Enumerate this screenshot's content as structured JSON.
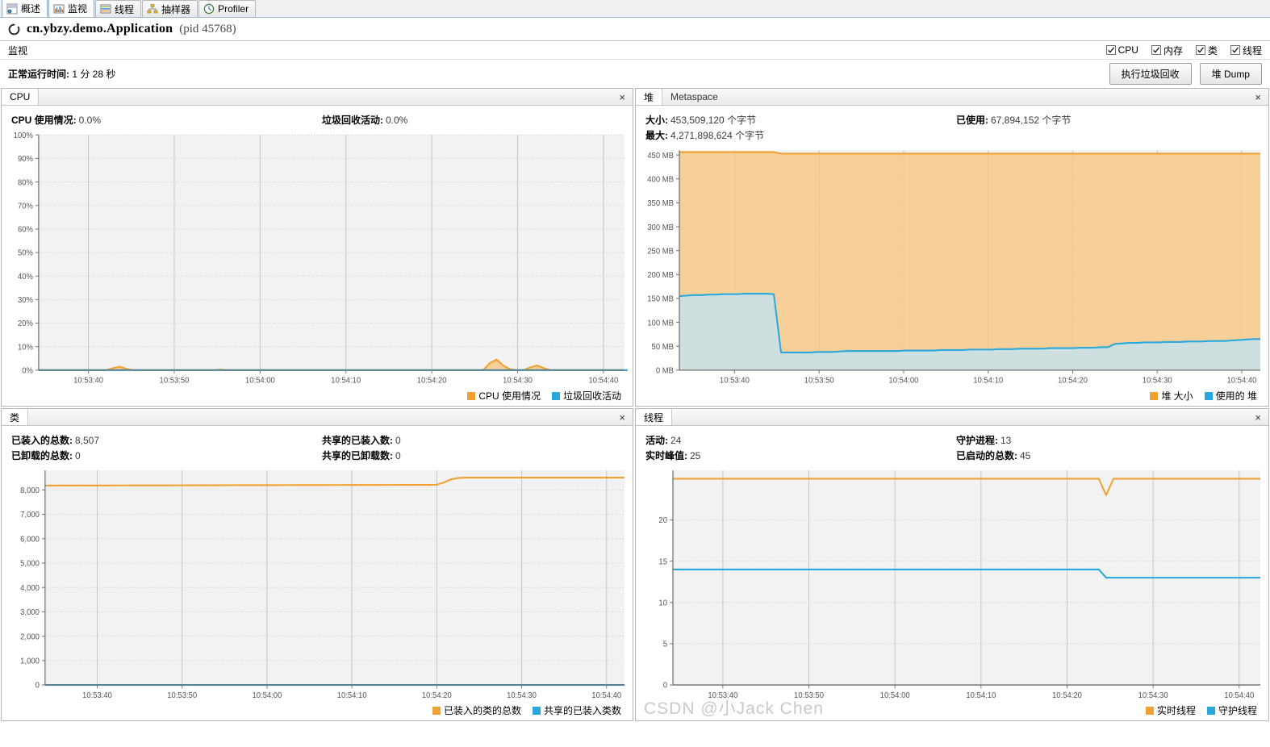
{
  "tabs": [
    {
      "label": "概述",
      "icon": "overview-icon",
      "active": false
    },
    {
      "label": "监视",
      "icon": "monitor-icon",
      "active": true
    },
    {
      "label": "线程",
      "icon": "threads-icon",
      "active": false
    },
    {
      "label": "抽样器",
      "icon": "sampler-icon",
      "active": false
    },
    {
      "label": "Profiler",
      "icon": "profiler-icon",
      "active": false
    }
  ],
  "app": {
    "name": "cn.ybzy.demo.Application",
    "pid": "(pid 45768)"
  },
  "monitor": {
    "label": "监视",
    "checkboxes": [
      {
        "label": "CPU",
        "checked": true
      },
      {
        "label": "内存",
        "checked": true
      },
      {
        "label": "类",
        "checked": true
      },
      {
        "label": "线程",
        "checked": true
      }
    ]
  },
  "uptime": {
    "label": "正常运行时间:",
    "value": "1 分 28 秒"
  },
  "buttons": {
    "gc": "执行垃圾回收",
    "heap_dump": "堆 Dump"
  },
  "colors": {
    "orange": "#f0a132",
    "orange_fill": "#f7c98a",
    "blue": "#29a8dd",
    "blue_fill": "#bfe6f7",
    "grid": "#cfcfcf",
    "plot_bg": "#f2f2f2",
    "axis": "#777777",
    "text": "#555555"
  },
  "panels": {
    "cpu": {
      "title": "CPU",
      "close": "×",
      "stats": [
        {
          "label": "CPU 使用情况:",
          "value": "0.0%"
        },
        {
          "label": "垃圾回收活动:",
          "value": "0.0%"
        }
      ],
      "legend": [
        {
          "label": "CPU 使用情况",
          "color": "#f0a132"
        },
        {
          "label": "垃圾回收活动",
          "color": "#29a8dd"
        }
      ]
    },
    "heap": {
      "title": "堆",
      "tab2": "Metaspace",
      "close": "×",
      "stats": [
        {
          "label": "大小:",
          "value": "453,509,120 个字节"
        },
        {
          "label": "已使用:",
          "value": "67,894,152 个字节"
        },
        {
          "label": "最大:",
          "value": "4,271,898,624 个字节"
        }
      ],
      "legend": [
        {
          "label": "堆 大小",
          "color": "#f0a132"
        },
        {
          "label": "使用的 堆",
          "color": "#29a8dd"
        }
      ]
    },
    "classes": {
      "title": "类",
      "close": "×",
      "stats": [
        {
          "label": "已装入的总数:",
          "value": "8,507"
        },
        {
          "label": "共享的已装入数:",
          "value": "0"
        },
        {
          "label": "已卸载的总数:",
          "value": "0"
        },
        {
          "label": "共享的已卸载数:",
          "value": "0"
        }
      ],
      "legend": [
        {
          "label": "已装入的类的总数",
          "color": "#f0a132"
        },
        {
          "label": "共享的已装入类数",
          "color": "#29a8dd"
        }
      ]
    },
    "threads": {
      "title": "线程",
      "close": "×",
      "stats": [
        {
          "label": "活动:",
          "value": "24"
        },
        {
          "label": "守护进程:",
          "value": "13"
        },
        {
          "label": "实时峰值:",
          "value": "25"
        },
        {
          "label": "已启动的总数:",
          "value": "45"
        }
      ],
      "legend": [
        {
          "label": "实时线程",
          "color": "#f0a132"
        },
        {
          "label": "守护线程",
          "color": "#29a8dd"
        }
      ]
    }
  },
  "watermark": "CSDN @小Jack Chen",
  "chart_data": [
    {
      "type": "area",
      "name": "cpu",
      "title": "CPU",
      "xlabel": "",
      "ylabel": "",
      "grid": true,
      "legend_position": "bottom-right",
      "xticks": [
        "10:53:40",
        "10:53:50",
        "10:54:00",
        "10:54:10",
        "10:54:20",
        "10:54:30",
        "10:54:40"
      ],
      "yticks": [
        "0%",
        "10%",
        "20%",
        "30%",
        "40%",
        "50%",
        "60%",
        "70%",
        "80%",
        "90%",
        "100%"
      ],
      "ylim": [
        0,
        100
      ],
      "series": [
        {
          "name": "CPU 使用情况",
          "color": "#f0a132",
          "values": [
            0,
            0,
            0,
            0,
            0,
            0,
            0,
            0,
            0,
            0,
            0,
            0.8,
            1.5,
            0.6,
            0,
            0,
            0,
            0,
            0,
            0,
            0,
            0,
            0,
            0,
            0,
            0,
            0,
            0.3,
            0,
            0,
            0,
            0,
            0,
            0,
            0,
            0,
            0,
            0,
            0,
            0,
            0,
            0,
            0,
            0,
            0,
            0,
            0,
            0,
            0,
            0,
            0,
            0,
            0,
            0,
            0,
            0,
            0,
            0,
            0,
            0,
            0,
            0,
            0,
            0,
            0,
            0,
            0,
            3.0,
            4.5,
            2.0,
            0.4,
            0,
            0,
            1.2,
            2.0,
            0.9,
            0,
            0,
            0,
            0,
            0,
            0,
            0,
            0,
            0,
            0,
            0,
            0
          ]
        },
        {
          "name": "垃圾回收活动",
          "color": "#29a8dd",
          "values": [
            0,
            0,
            0,
            0,
            0,
            0,
            0,
            0,
            0,
            0,
            0,
            0,
            0,
            0,
            0,
            0,
            0,
            0,
            0,
            0,
            0,
            0,
            0,
            0,
            0,
            0,
            0,
            0,
            0,
            0,
            0,
            0,
            0,
            0,
            0,
            0,
            0,
            0,
            0,
            0,
            0,
            0,
            0,
            0,
            0,
            0,
            0,
            0,
            0,
            0,
            0,
            0,
            0,
            0,
            0,
            0,
            0,
            0,
            0,
            0,
            0,
            0,
            0,
            0,
            0,
            0,
            0,
            0,
            0,
            0,
            0,
            0,
            0,
            0,
            0,
            0,
            0,
            0,
            0,
            0,
            0,
            0,
            0,
            0,
            0,
            0,
            0,
            0,
            0,
            0,
            0
          ]
        }
      ]
    },
    {
      "type": "area",
      "name": "heap",
      "title": "堆",
      "xlabel": "",
      "ylabel": "MB",
      "grid": true,
      "legend_position": "bottom-right",
      "xticks": [
        "10:53:40",
        "10:53:50",
        "10:54:00",
        "10:54:10",
        "10:54:20",
        "10:54:30",
        "10:54:40"
      ],
      "yticks": [
        "0 MB",
        "50 MB",
        "100 MB",
        "150 MB",
        "200 MB",
        "250 MB",
        "300 MB",
        "350 MB",
        "400 MB",
        "450 MB"
      ],
      "ylim": [
        0,
        460
      ],
      "series": [
        {
          "name": "堆 大小",
          "color": "#f0a132",
          "values": [
            456,
            456,
            456,
            456,
            456,
            456,
            456,
            456,
            456,
            456,
            456,
            456,
            456,
            456,
            453,
            453,
            453,
            453,
            453,
            453,
            453,
            453,
            453,
            453,
            453,
            453,
            453,
            453,
            453,
            453,
            453,
            453,
            453,
            453,
            453,
            453,
            453,
            453,
            453,
            453,
            453,
            453,
            453,
            453,
            453,
            453,
            453,
            453,
            453,
            453,
            453,
            453,
            453,
            453,
            453,
            453,
            453,
            453,
            453,
            453,
            453,
            453,
            453,
            453,
            453,
            453,
            453,
            453,
            453,
            453,
            453,
            453,
            453,
            453,
            453,
            453,
            453,
            453,
            453,
            453,
            453
          ]
        },
        {
          "name": "使用的 堆",
          "color": "#29a8dd",
          "values": [
            155,
            156,
            157,
            157,
            158,
            158,
            159,
            159,
            159,
            160,
            160,
            160,
            160,
            159,
            37,
            37,
            37,
            37,
            37,
            38,
            38,
            38,
            39,
            40,
            40,
            40,
            40,
            40,
            40,
            40,
            40,
            41,
            41,
            41,
            41,
            41,
            42,
            42,
            42,
            42,
            43,
            43,
            43,
            43,
            44,
            44,
            44,
            45,
            45,
            45,
            45,
            46,
            46,
            46,
            46,
            47,
            47,
            47,
            48,
            48,
            55,
            56,
            57,
            57,
            58,
            58,
            58,
            59,
            59,
            59,
            60,
            60,
            60,
            61,
            61,
            61,
            62,
            63,
            64,
            65,
            65
          ]
        }
      ]
    },
    {
      "type": "line",
      "name": "classes",
      "title": "类",
      "xlabel": "",
      "ylabel": "",
      "grid": true,
      "legend_position": "bottom-right",
      "xticks": [
        "10:53:40",
        "10:53:50",
        "10:54:00",
        "10:54:10",
        "10:54:20",
        "10:54:30",
        "10:54:40"
      ],
      "yticks": [
        "0",
        "1,000",
        "2,000",
        "3,000",
        "4,000",
        "5,000",
        "6,000",
        "7,000",
        "8,000"
      ],
      "ylim": [
        0,
        8800
      ],
      "series": [
        {
          "name": "已装入的类的总数",
          "color": "#f0a132",
          "values": [
            8180,
            8180,
            8182,
            8182,
            8183,
            8183,
            8184,
            8184,
            8185,
            8185,
            8186,
            8186,
            8187,
            8187,
            8188,
            8188,
            8189,
            8189,
            8190,
            8190,
            8191,
            8191,
            8192,
            8193,
            8193,
            8194,
            8194,
            8195,
            8195,
            8196,
            8196,
            8197,
            8197,
            8198,
            8198,
            8199,
            8200,
            8200,
            8201,
            8201,
            8202,
            8202,
            8203,
            8203,
            8204,
            8205,
            8205,
            8206,
            8206,
            8207,
            8207,
            8208,
            8208,
            8209,
            8210,
            8300,
            8430,
            8490,
            8505,
            8507,
            8507,
            8507,
            8507,
            8507,
            8507,
            8507,
            8507,
            8507,
            8507,
            8507,
            8507,
            8507,
            8507,
            8507,
            8507,
            8507,
            8507,
            8507,
            8507,
            8507,
            8507
          ]
        },
        {
          "name": "共享的已装入类数",
          "color": "#29a8dd",
          "values": [
            0,
            0,
            0,
            0,
            0,
            0,
            0,
            0,
            0,
            0,
            0,
            0,
            0,
            0,
            0,
            0,
            0,
            0,
            0,
            0,
            0,
            0,
            0,
            0,
            0,
            0,
            0,
            0,
            0,
            0,
            0,
            0,
            0,
            0,
            0,
            0,
            0,
            0,
            0,
            0,
            0,
            0,
            0,
            0,
            0,
            0,
            0,
            0,
            0,
            0,
            0,
            0,
            0,
            0,
            0,
            0,
            0,
            0,
            0,
            0,
            0,
            0,
            0,
            0,
            0,
            0,
            0,
            0,
            0,
            0,
            0,
            0,
            0,
            0,
            0,
            0,
            0,
            0,
            0,
            0,
            0
          ]
        }
      ]
    },
    {
      "type": "line",
      "name": "threads",
      "title": "线程",
      "xlabel": "",
      "ylabel": "",
      "grid": true,
      "legend_position": "bottom-right",
      "xticks": [
        "10:53:40",
        "10:53:50",
        "10:54:00",
        "10:54:10",
        "10:54:20",
        "10:54:30",
        "10:54:40"
      ],
      "yticks": [
        "0",
        "5",
        "10",
        "15",
        "20"
      ],
      "ylim": [
        0,
        26
      ],
      "series": [
        {
          "name": "实时线程",
          "color": "#f0a132",
          "values": [
            25,
            25,
            25,
            25,
            25,
            25,
            25,
            25,
            25,
            25,
            25,
            25,
            25,
            25,
            25,
            25,
            25,
            25,
            25,
            25,
            25,
            25,
            25,
            25,
            25,
            25,
            25,
            25,
            25,
            25,
            25,
            25,
            25,
            25,
            25,
            25,
            25,
            25,
            25,
            25,
            25,
            25,
            25,
            25,
            25,
            25,
            25,
            25,
            25,
            25,
            25,
            25,
            25,
            25,
            25,
            25,
            25,
            25,
            25,
            23,
            25,
            25,
            25,
            25,
            25,
            25,
            25,
            25,
            25,
            25,
            25,
            25,
            25,
            25,
            25,
            25,
            25,
            25,
            25,
            25,
            25
          ]
        },
        {
          "name": "守护线程",
          "color": "#29a8dd",
          "values": [
            14,
            14,
            14,
            14,
            14,
            14,
            14,
            14,
            14,
            14,
            14,
            14,
            14,
            14,
            14,
            14,
            14,
            14,
            14,
            14,
            14,
            14,
            14,
            14,
            14,
            14,
            14,
            14,
            14,
            14,
            14,
            14,
            14,
            14,
            14,
            14,
            14,
            14,
            14,
            14,
            14,
            14,
            14,
            14,
            14,
            14,
            14,
            14,
            14,
            14,
            14,
            14,
            14,
            14,
            14,
            14,
            14,
            14,
            14,
            13,
            13,
            13,
            13,
            13,
            13,
            13,
            13,
            13,
            13,
            13,
            13,
            13,
            13,
            13,
            13,
            13,
            13,
            13,
            13,
            13,
            13
          ]
        }
      ]
    }
  ]
}
